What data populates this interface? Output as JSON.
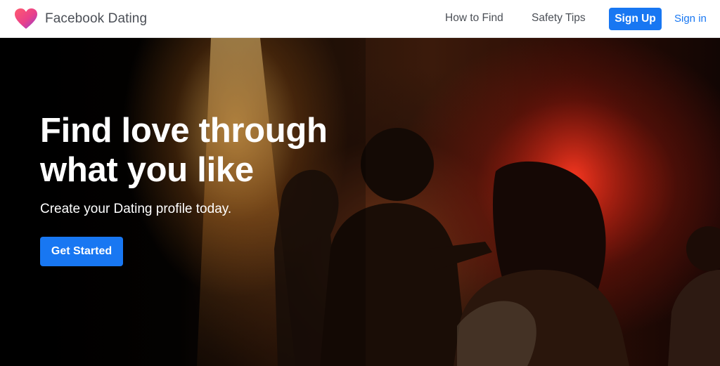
{
  "header": {
    "brand_name": "Facebook Dating",
    "logo_icon": "heart-logo-icon",
    "nav": {
      "how_to_find": "How to Find",
      "safety_tips": "Safety Tips",
      "sign_up": "Sign Up",
      "sign_in": "Sign in"
    }
  },
  "hero": {
    "headline_line1": "Find love through",
    "headline_line2": "what you like",
    "subheadline": "Create your Dating profile today.",
    "cta_label": "Get Started"
  },
  "colors": {
    "accent": "#1877f2",
    "header_bg": "#ffffff",
    "nav_text": "#4b4f56",
    "heart_pink": "#f5457a",
    "heart_purple": "#8f3fd3"
  }
}
